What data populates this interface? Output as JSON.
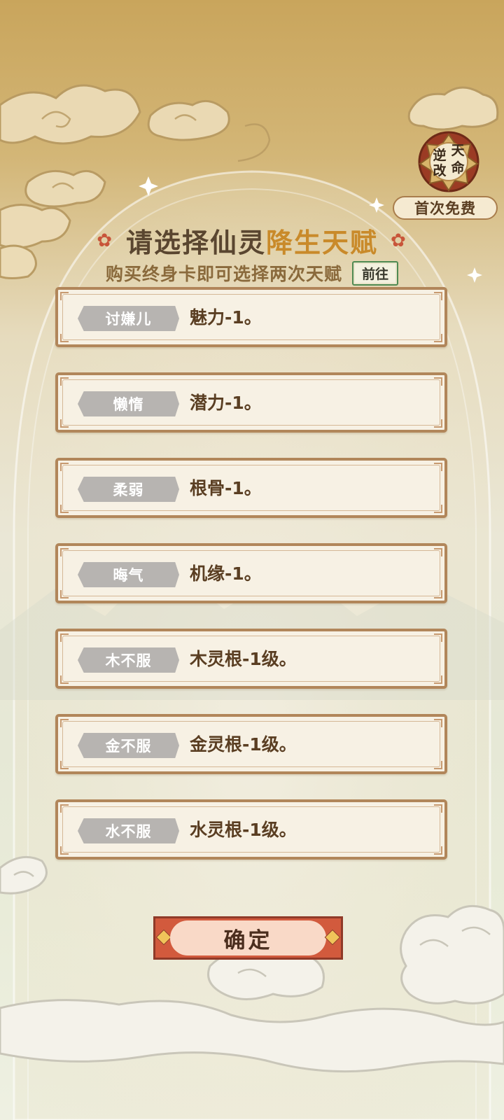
{
  "header": {
    "title_part1": "请选择仙灵",
    "title_part2": "降生天赋",
    "subtitle": "购买终身卡即可选择两次天赋",
    "goto_label": "前往"
  },
  "badge": {
    "seal_chars": [
      "逆",
      "天",
      "改",
      "命"
    ],
    "free_label": "首次免费"
  },
  "talents": [
    {
      "tag": "讨嫌儿",
      "desc": "魅力-1。"
    },
    {
      "tag": "懒惰",
      "desc": "潜力-1。"
    },
    {
      "tag": "柔弱",
      "desc": "根骨-1。"
    },
    {
      "tag": "晦气",
      "desc": "机缘-1。"
    },
    {
      "tag": "木不服",
      "desc": "木灵根-1级。"
    },
    {
      "tag": "金不服",
      "desc": "金灵根-1级。"
    },
    {
      "tag": "水不服",
      "desc": "水灵根-1级。"
    }
  ],
  "confirm_label": "确定",
  "colors": {
    "accent": "#c98a2a",
    "card_border": "#b1865a",
    "confirm_red": "#d25a3d"
  }
}
